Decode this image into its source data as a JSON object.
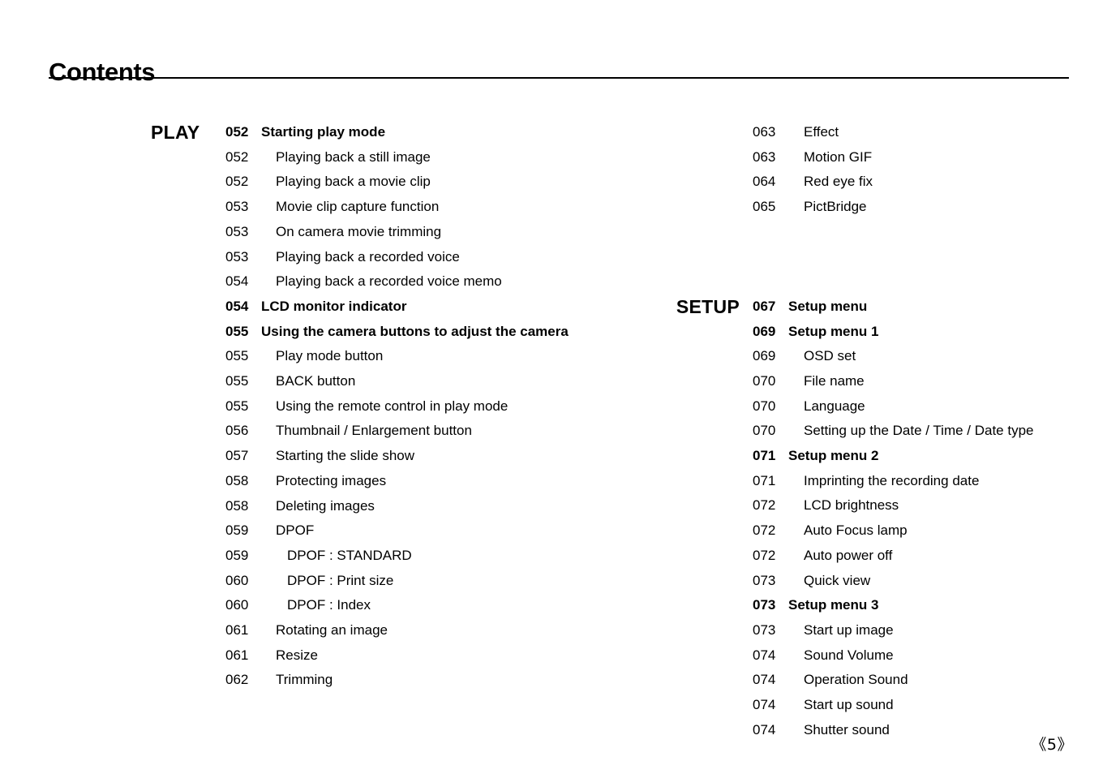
{
  "header": {
    "title": "Contents"
  },
  "footer": {
    "page_number": "《5》"
  },
  "columns": {
    "left": {
      "sections": [
        {
          "label": "PLAY",
          "entries": [
            {
              "num": "052",
              "label": "Starting play mode",
              "level": 0
            },
            {
              "num": "052",
              "label": "Playing back a still image",
              "level": 1
            },
            {
              "num": "052",
              "label": "Playing back a movie clip",
              "level": 1
            },
            {
              "num": "053",
              "label": "Movie clip capture function",
              "level": 1
            },
            {
              "num": "053",
              "label": "On camera movie trimming",
              "level": 1
            },
            {
              "num": "053",
              "label": "Playing back a recorded voice",
              "level": 1
            },
            {
              "num": "054",
              "label": "Playing back a recorded voice memo",
              "level": 1
            },
            {
              "num": "054",
              "label": "LCD monitor indicator",
              "level": 0
            },
            {
              "num": "055",
              "label": "Using the camera buttons to adjust the camera",
              "level": 0
            },
            {
              "num": "055",
              "label": "Play mode button",
              "level": 1
            },
            {
              "num": "055",
              "label": "BACK button",
              "level": 1
            },
            {
              "num": "055",
              "label": "Using the remote control in play mode",
              "level": 1
            },
            {
              "num": "056",
              "label": "Thumbnail / Enlargement button",
              "level": 1
            },
            {
              "num": "057",
              "label": "Starting the slide show",
              "level": 1
            },
            {
              "num": "058",
              "label": "Protecting images",
              "level": 1
            },
            {
              "num": "058",
              "label": "Deleting images",
              "level": 1
            },
            {
              "num": "059",
              "label": "DPOF",
              "level": 1
            },
            {
              "num": "059",
              "label": "DPOF : STANDARD",
              "level": 2
            },
            {
              "num": "060",
              "label": "DPOF : Print size",
              "level": 2
            },
            {
              "num": "060",
              "label": "DPOF : Index",
              "level": 2
            },
            {
              "num": "061",
              "label": "Rotating an image",
              "level": 1
            },
            {
              "num": "061",
              "label": "Resize",
              "level": 1
            },
            {
              "num": "062",
              "label": "Trimming",
              "level": 1
            }
          ]
        }
      ]
    },
    "right": {
      "sections": [
        {
          "label": "",
          "entries": [
            {
              "num": "063",
              "label": "Effect",
              "level": 1
            },
            {
              "num": "063",
              "label": "Motion GIF",
              "level": 1
            },
            {
              "num": "064",
              "label": "Red eye fix",
              "level": 1
            },
            {
              "num": "065",
              "label": "PictBridge",
              "level": 1
            }
          ]
        },
        {
          "label": "SETUP",
          "entries": [
            {
              "num": "067",
              "label": "Setup menu",
              "level": 0
            },
            {
              "num": "069",
              "label": "Setup menu 1",
              "level": 0
            },
            {
              "num": "069",
              "label": "OSD set",
              "level": 1
            },
            {
              "num": "070",
              "label": "File name",
              "level": 1
            },
            {
              "num": "070",
              "label": "Language",
              "level": 1
            },
            {
              "num": "070",
              "label": "Setting up the Date / Time / Date type",
              "level": 1
            },
            {
              "num": "071",
              "label": "Setup menu 2",
              "level": 0
            },
            {
              "num": "071",
              "label": "Imprinting the recording date",
              "level": 1
            },
            {
              "num": "072",
              "label": "LCD brightness",
              "level": 1
            },
            {
              "num": "072",
              "label": "Auto Focus lamp",
              "level": 1
            },
            {
              "num": "072",
              "label": "Auto power off",
              "level": 1
            },
            {
              "num": "073",
              "label": "Quick view",
              "level": 1
            },
            {
              "num": "073",
              "label": "Setup menu 3",
              "level": 0
            },
            {
              "num": "073",
              "label": "Start up image",
              "level": 1
            },
            {
              "num": "074",
              "label": "Sound Volume",
              "level": 1
            },
            {
              "num": "074",
              "label": "Operation Sound",
              "level": 1
            },
            {
              "num": "074",
              "label": "Start up sound",
              "level": 1
            },
            {
              "num": "074",
              "label": "Shutter sound",
              "level": 1
            }
          ]
        }
      ]
    }
  }
}
